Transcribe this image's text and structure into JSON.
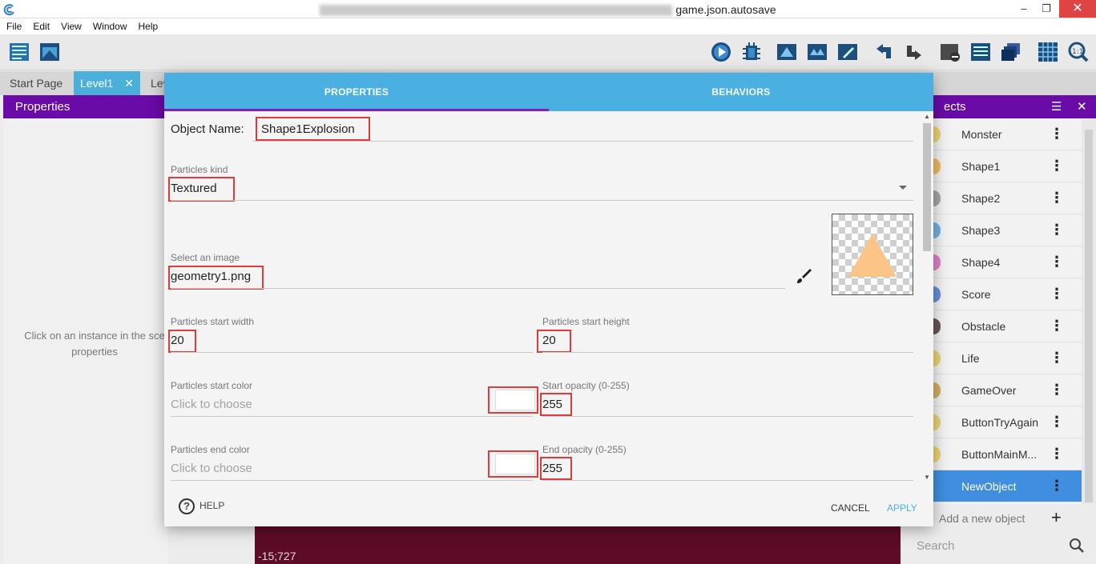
{
  "window": {
    "title_suffix": "game.json.autosave",
    "controls": {
      "minimize": "–",
      "restore": "❐",
      "close": "✕"
    }
  },
  "menu": [
    "File",
    "Edit",
    "View",
    "Window",
    "Help"
  ],
  "tabs": [
    {
      "label": "Start Page"
    },
    {
      "label": "Level1",
      "close": "✕"
    },
    {
      "label": "Lev"
    }
  ],
  "left_panel": {
    "title": "Properties",
    "hint_line1": "Click on an instance in the sce",
    "hint_line2": "properties"
  },
  "scene": {
    "coords": "-15;727"
  },
  "objects_panel": {
    "title": "ects",
    "items": [
      {
        "label": "Monster",
        "color": "#e8c94a"
      },
      {
        "label": "Shape1",
        "color": "#f0a830"
      },
      {
        "label": "Shape2",
        "color": "#8c8c8c"
      },
      {
        "label": "Shape3",
        "color": "#4a9ad8"
      },
      {
        "label": "Shape4",
        "color": "#d85ab8"
      },
      {
        "label": "Score",
        "color": "#3a6ad8"
      },
      {
        "label": "Obstacle",
        "color": "#3a2020"
      },
      {
        "label": "Life",
        "color": "#e8c94a"
      },
      {
        "label": "GameOver",
        "color": "#c89a30"
      },
      {
        "label": "ButtonTryAgain",
        "color": "#e8c94a"
      },
      {
        "label": "ButtonMainM...",
        "color": "#e8c94a"
      },
      {
        "label": "NewObject",
        "color": "#3f8ee0",
        "selected": true
      }
    ],
    "add_label": "Add a new object",
    "add_icon": "+",
    "search_placeholder": "Search"
  },
  "dialog": {
    "tabs": {
      "properties": "PROPERTIES",
      "behaviors": "BEHAVIORS"
    },
    "object_name_label": "Object Name:",
    "object_name": "Shape1Explosion",
    "particles_kind_label": "Particles kind",
    "particles_kind": "Textured",
    "select_image_label": "Select an image",
    "image_name": "geometry1.png",
    "start_width_label": "Particles start width",
    "start_width": "20",
    "start_height_label": "Particles start height",
    "start_height": "20",
    "start_color_label": "Particles start color",
    "start_color_placeholder": "Click to choose",
    "start_opacity_label": "Start opacity (0-255)",
    "start_opacity": "255",
    "end_color_label": "Particles end color",
    "end_color_placeholder": "Click to choose",
    "end_opacity_label": "End opacity (0-255)",
    "end_opacity": "255",
    "help": "HELP",
    "cancel": "CANCEL",
    "apply": "APPLY",
    "accent_color": "#4ab0e2",
    "tab_indicator_color": "#7b22b8",
    "highlight_color": "#e03b3b"
  }
}
